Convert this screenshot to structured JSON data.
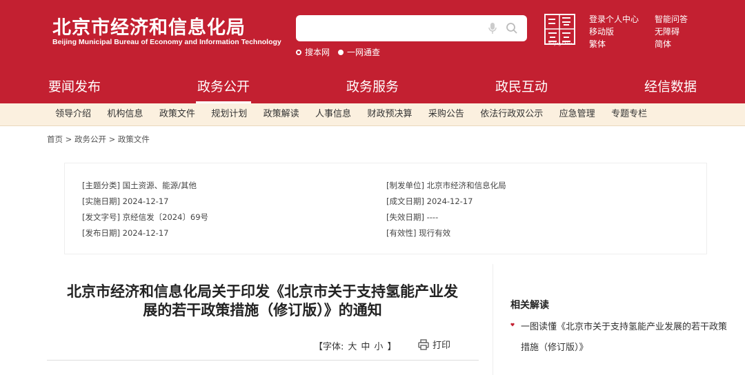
{
  "header": {
    "site_title": "北京市经济和信息化局",
    "site_subtitle": "Beijing Municipal Bureau of Economy and Information Technology",
    "search": {
      "placeholder": "",
      "value": ""
    },
    "radio_options": [
      "搜本网",
      "一网通查"
    ],
    "logo_caption": "Beijing·China",
    "top_links_col1": [
      "登录个人中心",
      "移动版",
      "繁体"
    ],
    "top_links_col2": [
      "智能问答",
      "无障碍",
      "简体"
    ]
  },
  "main_nav": [
    {
      "label": "要闻发布",
      "active": false
    },
    {
      "label": "政务公开",
      "active": true
    },
    {
      "label": "政务服务",
      "active": false
    },
    {
      "label": "政民互动",
      "active": false
    },
    {
      "label": "经信数据",
      "active": false
    }
  ],
  "sub_nav": [
    "领导介绍",
    "机构信息",
    "政策文件",
    "规划计划",
    "政策解读",
    "人事信息",
    "财政预决算",
    "采购公告",
    "依法行政双公示",
    "应急管理",
    "专题专栏"
  ],
  "breadcrumb": [
    "首页",
    "政务公开",
    "政策文件"
  ],
  "breadcrumb_sep": ">",
  "meta": {
    "left": [
      "[主题分类] 国土资源、能源/其他",
      "[实施日期] 2024-12-17",
      "[发文字号] 京经信发〔2024〕69号",
      "[发布日期] 2024-12-17"
    ],
    "right": [
      "[制发单位] 北京市经济和信息化局",
      "[成文日期] 2024-12-17",
      "[失效日期] ----",
      "[有效性] 现行有效"
    ]
  },
  "document": {
    "title_line1": "北京市经济和信息化局关于印发《北京市关于支持氢能产业发",
    "title_line2": "展的若干政策措施（修订版）》的通知",
    "font_label_prefix": "【字体:",
    "font_sizes": [
      "大",
      "中",
      "小"
    ],
    "font_label_suffix": "】",
    "print_label": "打印"
  },
  "related": {
    "title": "相关解读",
    "items": [
      "一图读懂《北京市关于支持氢能产业发展的若干政策措施（修订版）》"
    ]
  },
  "colors": {
    "brand_red": "#c32031",
    "subnav_bg": "#fbf0df"
  }
}
